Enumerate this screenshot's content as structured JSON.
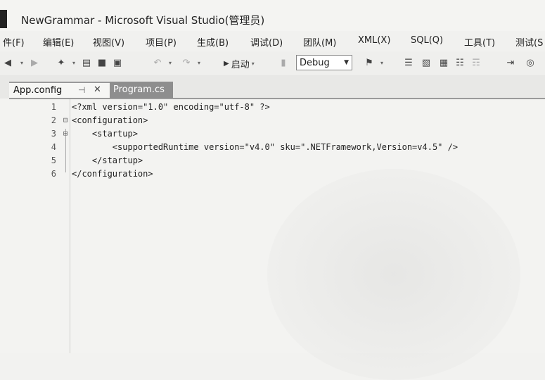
{
  "window": {
    "title": "NewGrammar - Microsoft Visual Studio(管理员)"
  },
  "menu": {
    "items": [
      {
        "label": "件(F)"
      },
      {
        "label": "编辑(E)"
      },
      {
        "label": "视图(V)"
      },
      {
        "label": "项目(P)"
      },
      {
        "label": "生成(B)"
      },
      {
        "label": "调试(D)"
      },
      {
        "label": "团队(M)"
      },
      {
        "label": "XML(X)"
      },
      {
        "label": "SQL(Q)"
      },
      {
        "label": "工具(T)"
      },
      {
        "label": "测试(S"
      }
    ]
  },
  "toolbar": {
    "start_label": "启动",
    "configuration": "Debug"
  },
  "tabs": {
    "active": {
      "label": "App.config"
    },
    "inactive": {
      "label": "Program.cs"
    }
  },
  "editor": {
    "lines": [
      {
        "num": "1",
        "text": "<?xml version=\"1.0\" encoding=\"utf-8\" ?>"
      },
      {
        "num": "2",
        "text": "<configuration>"
      },
      {
        "num": "3",
        "text": "    <startup>"
      },
      {
        "num": "4",
        "text": "        <supportedRuntime version=\"v4.0\" sku=\".NETFramework,Version=v4.5\" />"
      },
      {
        "num": "5",
        "text": "    </startup>"
      },
      {
        "num": "6",
        "text": "</configuration>"
      }
    ]
  },
  "icons": {
    "back": "back-icon",
    "forward": "forward-icon",
    "new_project": "new-project-icon",
    "open": "open-icon",
    "save": "save-icon",
    "save_all": "save-all-icon",
    "undo": "undo-icon",
    "redo": "redo-icon",
    "play": "play-icon"
  }
}
